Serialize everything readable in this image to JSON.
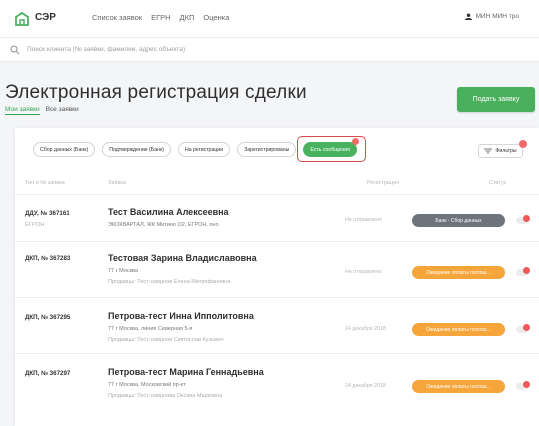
{
  "app": {
    "logo_text": "СЭР",
    "nav": [
      "Список заявок",
      "ЕГРН",
      "ДКП",
      "Оценка"
    ],
    "user": "МИН МИН тро"
  },
  "search": {
    "placeholder": "Поиск клиента (№ заявки, фамилии, адрес объекта)"
  },
  "page": {
    "title": "Электронная регистрация сделки",
    "tabs": [
      "Мои заявки",
      "Все заявки"
    ],
    "submit_label": "Подать заявку"
  },
  "filters": {
    "chips": [
      "Сбор данных (Банк)",
      "Подтверждение (Банк)",
      "На регистрации",
      "Зарегистрированы",
      "Есть сообщения"
    ],
    "active_index": 4,
    "filter_button": "Фильтры"
  },
  "columns": [
    "Тип и № заявки",
    "Заявка",
    "Регистрация",
    "Статус"
  ],
  "rows": [
    {
      "id": "ДДУ, № 367161",
      "sub": "ЕГРОН",
      "name": "Тест Василина Алексеевна",
      "line1": "ЭКОКВАРТАЛ, ЖК Митино О2, ЕГРОН, оно",
      "line2": "",
      "registration": "Не отправлено",
      "status": "Банк - Сбор данных",
      "status_color": "grey"
    },
    {
      "id": "ДКП, № 367283",
      "sub": "",
      "name": "Тестовая Зарина Владиславовна",
      "line1": "77   г Москва",
      "line2": "Продавцы: Тест-смирнов Елена Митрофановна",
      "registration": "Не отправлено",
      "status": "Ожидание оплаты госпош...",
      "status_color": "orange"
    },
    {
      "id": "ДКП, № 367295",
      "sub": "",
      "name": "Петрова-тест Инна Ипполитовна",
      "line1": "77   г Москва, линия Северная 5-я",
      "line2": "Продавцы: Тест-смирнов Святослав Кузьмич",
      "registration": "24 декабря 2018",
      "status": "Ожидание оплаты госпош...",
      "status_color": "orange"
    },
    {
      "id": "ДКП, № 367297",
      "sub": "",
      "name": "Петрова-тест Марина Геннадьевна",
      "line1": "77   г Москва, Московский пр-кт",
      "line2": "Продавцы: Тест-смирнова Оксана Марковна",
      "registration": "24 декабря 2018",
      "status": "Ожидание оплаты госпош...",
      "status_color": "orange"
    }
  ],
  "colors": {
    "accent": "#4bb05e",
    "alert": "#d94c4c",
    "status_orange": "#f5a53a",
    "status_grey": "#6d747c"
  }
}
